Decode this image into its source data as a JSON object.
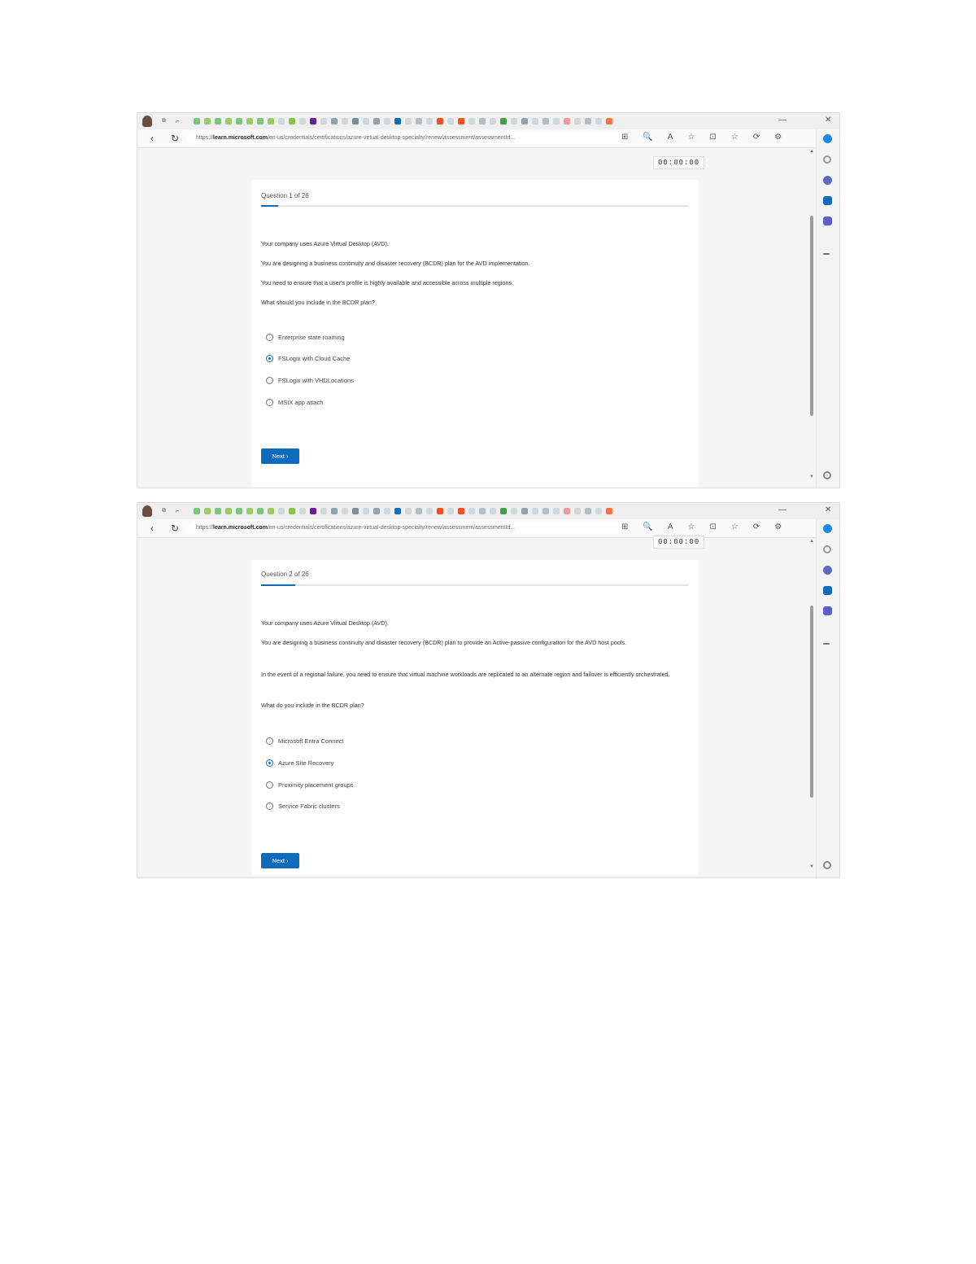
{
  "browser": {
    "url_prefix": "https://",
    "url_domain": "learn.microsoft.com",
    "url_path": "/en-us/credentials/certifications/azure-virtual-desktop-specialty/renew/assessment/assessmentId...",
    "window_controls": {
      "minimize": "—",
      "close": "✕"
    },
    "nav": {
      "back": "‹",
      "reload": "↻",
      "lock": "🔒"
    },
    "toolbar_icons": [
      "⊞",
      "🔍",
      "A",
      "☆",
      "⊡",
      "☆",
      "⟳",
      "⚙"
    ],
    "sidebar_icons": [
      "search-icon",
      "copilot-icon",
      "outlook-icon",
      "teams-icon",
      "plus-icon",
      "settings-icon"
    ],
    "colors": {
      "accent": "#0f6cbd",
      "edge_logo": "#1e88e5"
    }
  },
  "shots": [
    {
      "timer": "00:00:00",
      "question_counter": "Question 1 of 26",
      "paragraphs": [
        "Your company uses Azure Virtual Desktop (AVD).",
        "You are designing a business continuity and disaster recovery (BCDR) plan for the AVD implementation.",
        "You need to ensure that a user's profile is highly available and accessible across multiple regions.",
        "What should you include in the BCDR plan?"
      ],
      "options": [
        {
          "label": "Enterprise state roaming",
          "selected": false
        },
        {
          "label": "FSLogix with Cloud Cache",
          "selected": true
        },
        {
          "label": "FSLogix with VHDLocations",
          "selected": false
        },
        {
          "label": "MSIX app attach",
          "selected": false
        }
      ],
      "next_label": "Next ›"
    },
    {
      "timer": "00:00:00",
      "question_counter": "Question 2 of 26",
      "paragraphs": [
        "Your company uses Azure Virtual Desktop (AVD).",
        "You are designing a business continuity and disaster recovery (BCDR) plan to provide an Active-passive configuration for the AVD host pools.",
        "In the event of a regional failure, you need to ensure that virtual machine workloads are replicated to an alternate region and failover is efficiently orchestrated.",
        "What do you include in the BCDR plan?"
      ],
      "options": [
        {
          "label": "Microsoft Entra Connect",
          "selected": false
        },
        {
          "label": "Azure Site Recovery",
          "selected": true
        },
        {
          "label": "Proximity placement groups",
          "selected": false
        },
        {
          "label": "Service Fabric clusters",
          "selected": false
        }
      ],
      "next_label": "Next ›"
    }
  ]
}
